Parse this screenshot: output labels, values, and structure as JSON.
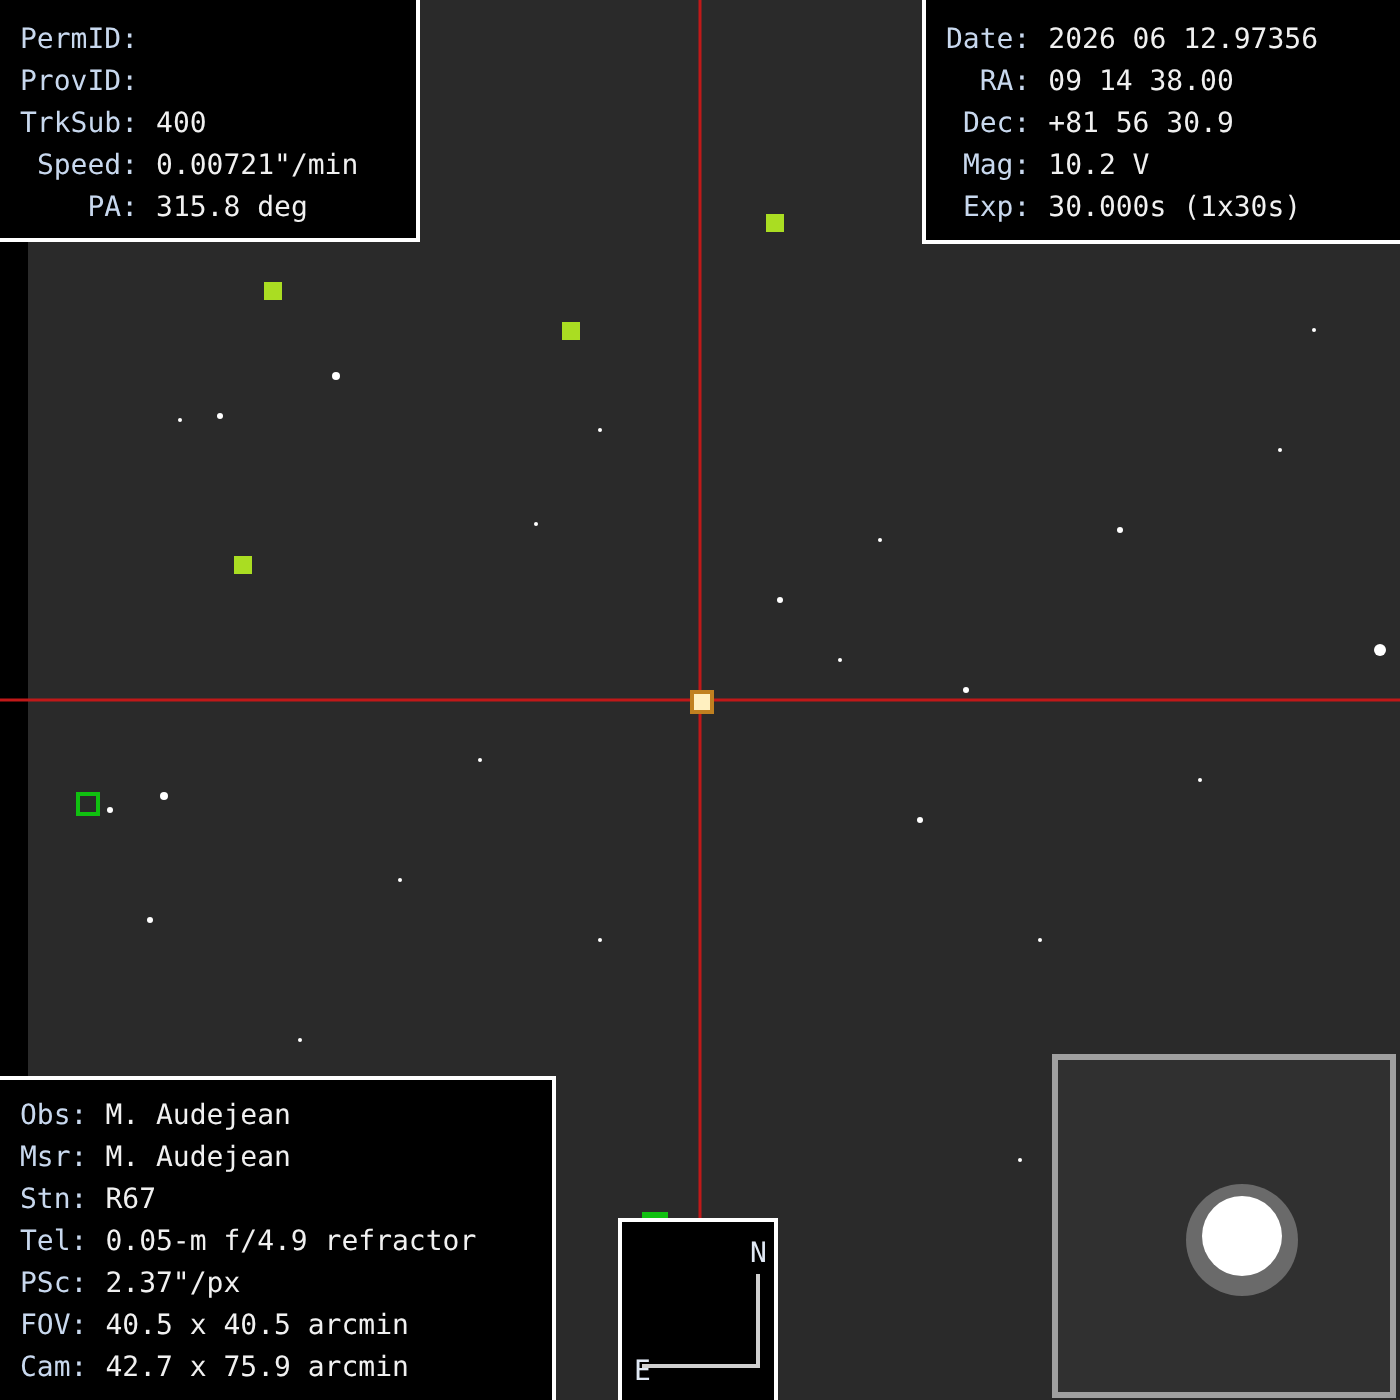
{
  "object_panel": [
    {
      "label": "PermID:"
    },
    {
      "label": "ProvID:"
    },
    {
      "label": "TrkSub:",
      "value": "400"
    },
    {
      "label": "Speed:",
      "value": "0.00721\"/min"
    },
    {
      "label": "PA:",
      "value": "315.8 deg"
    }
  ],
  "observation_panel": [
    {
      "label": "Date:",
      "value": "2026 06 12.97356"
    },
    {
      "label": "RA:",
      "value": "09 14 38.00"
    },
    {
      "label": "Dec:",
      "value": "+81 56 30.9"
    },
    {
      "label": "Mag:",
      "value": "10.2 V"
    },
    {
      "label": "Exp:",
      "value": "30.000s (1x30s)"
    }
  ],
  "station_panel": [
    {
      "label": "Obs:",
      "value": "M. Audejean"
    },
    {
      "label": "Msr:",
      "value": "M. Audejean"
    },
    {
      "label": "Stn:",
      "value": "R67"
    },
    {
      "label": "Tel:",
      "value": "0.05-m f/4.9 refractor"
    },
    {
      "label": "PSc:",
      "value": "2.37\"/px"
    },
    {
      "label": "FOV:",
      "value": "40.5 x 40.5 arcmin"
    },
    {
      "label": "Cam:",
      "value": "42.7 x 75.9 arcmin"
    }
  ],
  "compass": {
    "north": "N",
    "east": "E"
  }
}
